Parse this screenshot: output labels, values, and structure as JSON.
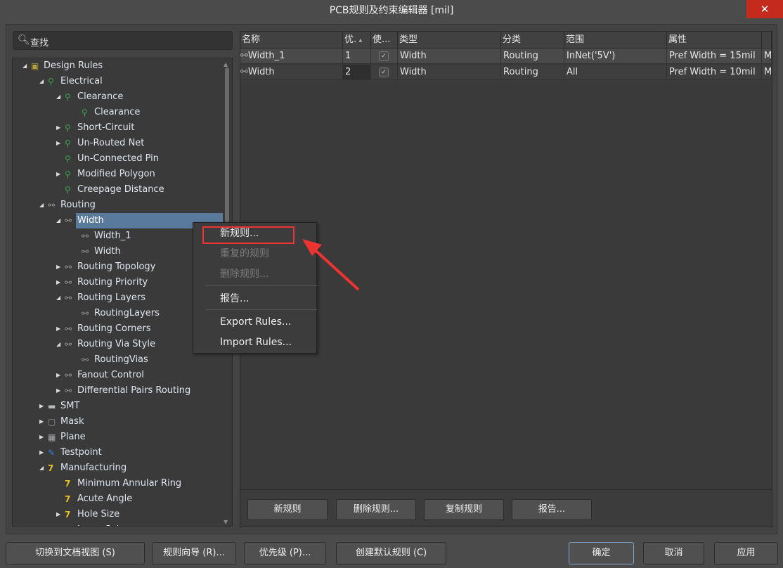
{
  "window": {
    "title": "PCB规则及约束编辑器 [mil]",
    "close_icon": "close-icon"
  },
  "search": {
    "placeholder": "查找"
  },
  "tree": [
    {
      "label": "Design Rules",
      "level": 0,
      "expander": "expanded",
      "icon": "rules-folder-icon"
    },
    {
      "label": "Electrical",
      "level": 1,
      "expander": "expanded",
      "icon": "electrical-icon"
    },
    {
      "label": "Clearance",
      "level": 2,
      "expander": "expanded",
      "icon": "electrical-icon"
    },
    {
      "label": "Clearance",
      "level": 3,
      "expander": "none",
      "icon": "electrical-icon"
    },
    {
      "label": "Short-Circuit",
      "level": 2,
      "expander": "collapsed",
      "icon": "electrical-icon"
    },
    {
      "label": "Un-Routed Net",
      "level": 2,
      "expander": "collapsed",
      "icon": "electrical-icon"
    },
    {
      "label": "Un-Connected Pin",
      "level": 2,
      "expander": "none",
      "icon": "electrical-icon"
    },
    {
      "label": "Modified Polygon",
      "level": 2,
      "expander": "collapsed",
      "icon": "electrical-icon"
    },
    {
      "label": "Creepage Distance",
      "level": 2,
      "expander": "none",
      "icon": "electrical-icon"
    },
    {
      "label": "Routing",
      "level": 1,
      "expander": "expanded",
      "icon": "routing-icon"
    },
    {
      "label": "Width",
      "level": 2,
      "expander": "expanded",
      "icon": "routing-icon",
      "selected": true
    },
    {
      "label": "Width_1",
      "level": 3,
      "expander": "none",
      "icon": "routing-icon"
    },
    {
      "label": "Width",
      "level": 3,
      "expander": "none",
      "icon": "routing-icon"
    },
    {
      "label": "Routing Topology",
      "level": 2,
      "expander": "collapsed",
      "icon": "routing-icon"
    },
    {
      "label": "Routing Priority",
      "level": 2,
      "expander": "collapsed",
      "icon": "routing-icon"
    },
    {
      "label": "Routing Layers",
      "level": 2,
      "expander": "expanded",
      "icon": "routing-icon"
    },
    {
      "label": "RoutingLayers",
      "level": 3,
      "expander": "none",
      "icon": "routing-icon"
    },
    {
      "label": "Routing Corners",
      "level": 2,
      "expander": "collapsed",
      "icon": "routing-icon"
    },
    {
      "label": "Routing Via Style",
      "level": 2,
      "expander": "expanded",
      "icon": "routing-icon"
    },
    {
      "label": "RoutingVias",
      "level": 3,
      "expander": "none",
      "icon": "routing-icon"
    },
    {
      "label": "Fanout Control",
      "level": 2,
      "expander": "collapsed",
      "icon": "routing-icon"
    },
    {
      "label": "Differential Pairs Routing",
      "level": 2,
      "expander": "collapsed",
      "icon": "routing-icon"
    },
    {
      "label": "SMT",
      "level": 1,
      "expander": "collapsed",
      "icon": "smt-icon"
    },
    {
      "label": "Mask",
      "level": 1,
      "expander": "collapsed",
      "icon": "mask-icon"
    },
    {
      "label": "Plane",
      "level": 1,
      "expander": "collapsed",
      "icon": "plane-icon"
    },
    {
      "label": "Testpoint",
      "level": 1,
      "expander": "collapsed",
      "icon": "testpoint-icon"
    },
    {
      "label": "Manufacturing",
      "level": 1,
      "expander": "expanded",
      "icon": "manufacturing-icon"
    },
    {
      "label": "Minimum Annular Ring",
      "level": 2,
      "expander": "none",
      "icon": "manufacturing-icon"
    },
    {
      "label": "Acute Angle",
      "level": 2,
      "expander": "none",
      "icon": "manufacturing-icon"
    },
    {
      "label": "Hole Size",
      "level": 2,
      "expander": "collapsed",
      "icon": "manufacturing-icon"
    },
    {
      "label": "Layer Pairs",
      "level": 2,
      "expander": "none",
      "icon": "manufacturing-icon"
    }
  ],
  "table": {
    "columns": [
      "名称",
      "优.",
      "使...",
      "类型",
      "分类",
      "范围",
      "属性"
    ],
    "sort": {
      "column": "优.",
      "direction": "ascending"
    },
    "rows": [
      {
        "name": "Width_1",
        "priority": "1",
        "enabled": true,
        "type": "Width",
        "category": "Routing",
        "scope": "InNet('5V')",
        "attributes": "Pref Width =  15mil",
        "more": "M"
      },
      {
        "name": "Width",
        "priority": "2",
        "enabled": true,
        "type": "Width",
        "category": "Routing",
        "scope": "All",
        "attributes": "Pref Width =  10mil",
        "more": "M"
      }
    ]
  },
  "panel_buttons": [
    "新规则",
    "删除规则...",
    "复制规则",
    "报告..."
  ],
  "context_menu": {
    "items": [
      {
        "label": "新规则...",
        "enabled": true,
        "highlighted": true
      },
      {
        "label": "重复的规则",
        "enabled": false
      },
      {
        "label": "删除规则...",
        "enabled": false
      },
      {
        "label": "报告...",
        "enabled": true
      },
      {
        "label": "Export Rules...",
        "enabled": true
      },
      {
        "label": "Import Rules...",
        "enabled": true
      }
    ]
  },
  "footer": {
    "left": [
      "切换到文档视图 (S)",
      "规则向导 (R)...",
      "优先级 (P)...",
      "创建默认规则 (C)"
    ],
    "ok": "确定",
    "cancel": "取消",
    "apply": "应用"
  },
  "annotation_color": "#ee3333"
}
